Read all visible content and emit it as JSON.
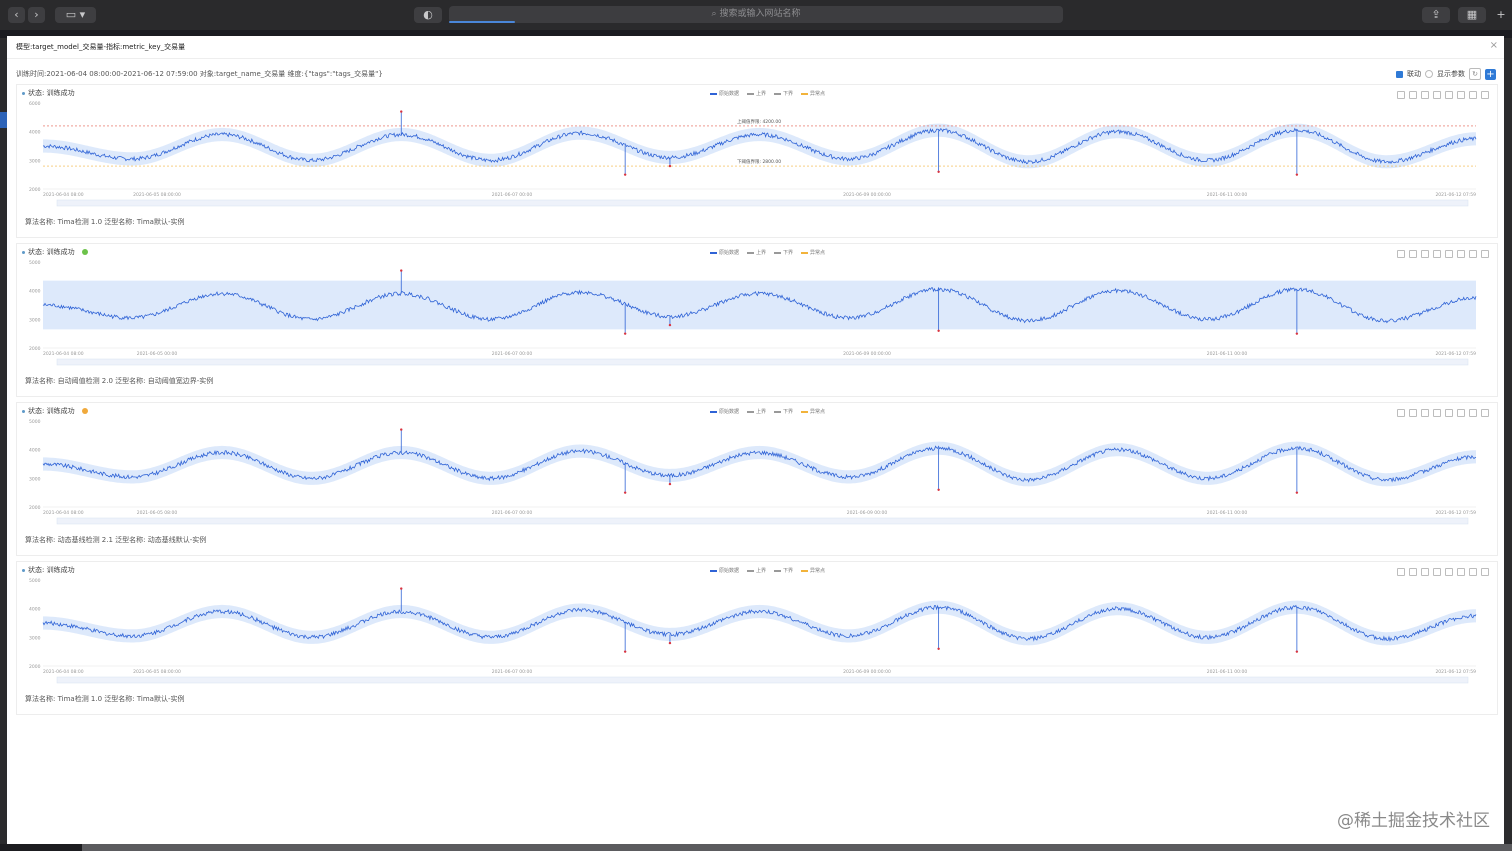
{
  "browser": {
    "address_placeholder": "搜索或输入网站名称"
  },
  "dialog": {
    "title": "模型:target_model_交易量-指标:metric_key_交易量",
    "info": "训练时间:2021-06-04 08:00:00-2021-06-12 07:59:00  对象:target_name_交易量  维度:{\"tags\":\"tags_交易量\"}",
    "link_label": "联动",
    "show_params_label": "显示参数"
  },
  "legend": {
    "raw": "原始数据",
    "upper": "上界",
    "lower": "下界",
    "extra": "异常点"
  },
  "colors": {
    "series": "#2f63d6",
    "band": "#dde9fb",
    "upper_threshold": "#e25b4b",
    "lower_threshold": "#f2b33b",
    "anomaly": "#d9333f",
    "badge_green": "#6cc24a",
    "badge_orange": "#f0a93b"
  },
  "panels": [
    {
      "status": "状态: 训练成功",
      "badge": "",
      "band": "curve",
      "thresholds": true,
      "upper_label": "上阈值界限: 4200.00",
      "lower_label": "下阈值界限: 2800.00",
      "footer": "算法名称: Tima检测 1.0    泛型名称: Tima默认-实例",
      "y_ticks": [
        "6000",
        "4000",
        "3000",
        "2000"
      ],
      "x_ticks": [
        "2021-06-04 08:00",
        "2021-06-05 08:00:00",
        "2021-06-07 00:00",
        "2021-06-09 00:00:00",
        "2021-06-11 00:00",
        "2021-06-12 07:59"
      ]
    },
    {
      "status": "状态: 训练成功",
      "badge": "green",
      "band": "rect",
      "thresholds": false,
      "footer": "算法名称: 自动阈值检测 2.0    泛型名称: 自动阈值宽边界-实例",
      "y_ticks": [
        "5000",
        "4000",
        "3000",
        "2000"
      ],
      "x_ticks": [
        "2021-06-04 08:00",
        "2021-06-05 00:00",
        "2021-06-07 00:00",
        "2021-06-09 00:00:00",
        "2021-06-11 00:00",
        "2021-06-12 07:59"
      ]
    },
    {
      "status": "状态: 训练成功",
      "badge": "orange",
      "band": "curve",
      "thresholds": false,
      "footer": "算法名称: 动态基线检测 2.1    泛型名称: 动态基线默认-实例",
      "y_ticks": [
        "5000",
        "4000",
        "3000",
        "2000"
      ],
      "x_ticks": [
        "2021-06-04 08:00",
        "2021-06-05 08:00",
        "2021-06-07 00:00",
        "2021-06-09 00:00",
        "2021-06-11 00:00",
        "2021-06-12 07:59"
      ]
    },
    {
      "status": "状态: 训练成功",
      "badge": "",
      "band": "curve",
      "thresholds": false,
      "footer": "算法名称: Tima检测 1.0    泛型名称: Tima默认-实例",
      "y_ticks": [
        "5000",
        "4000",
        "3000",
        "2000"
      ],
      "x_ticks": [
        "2021-06-04 08:00",
        "2021-06-05 08:00:00",
        "2021-06-07 00:00",
        "2021-06-09 00:00:00",
        "2021-06-11 00:00",
        "2021-06-12 07:59"
      ]
    }
  ],
  "chart_data": {
    "type": "line",
    "series": [
      {
        "name": "原始数据",
        "x": [
          "2021-06-04 08:00",
          "2021-06-04 20:00",
          "2021-06-05 08:00",
          "2021-06-05 20:00",
          "2021-06-06 08:00",
          "2021-06-06 20:00",
          "2021-06-07 08:00",
          "2021-06-07 20:00",
          "2021-06-08 08:00",
          "2021-06-08 20:00",
          "2021-06-09 08:00",
          "2021-06-09 20:00",
          "2021-06-10 08:00",
          "2021-06-10 20:00",
          "2021-06-11 08:00",
          "2021-06-11 20:00",
          "2021-06-12 07:59"
        ],
        "values": [
          3500,
          3050,
          3900,
          3000,
          3900,
          3000,
          3950,
          3100,
          3900,
          3050,
          4050,
          2950,
          4000,
          3000,
          4050,
          2950,
          3750
        ]
      }
    ],
    "anomaly_values": [
      4700,
      2500,
      2800,
      2600,
      2500
    ],
    "upper_threshold": 4200,
    "lower_threshold": 2800
  },
  "watermark": "@稀土掘金技术社区"
}
